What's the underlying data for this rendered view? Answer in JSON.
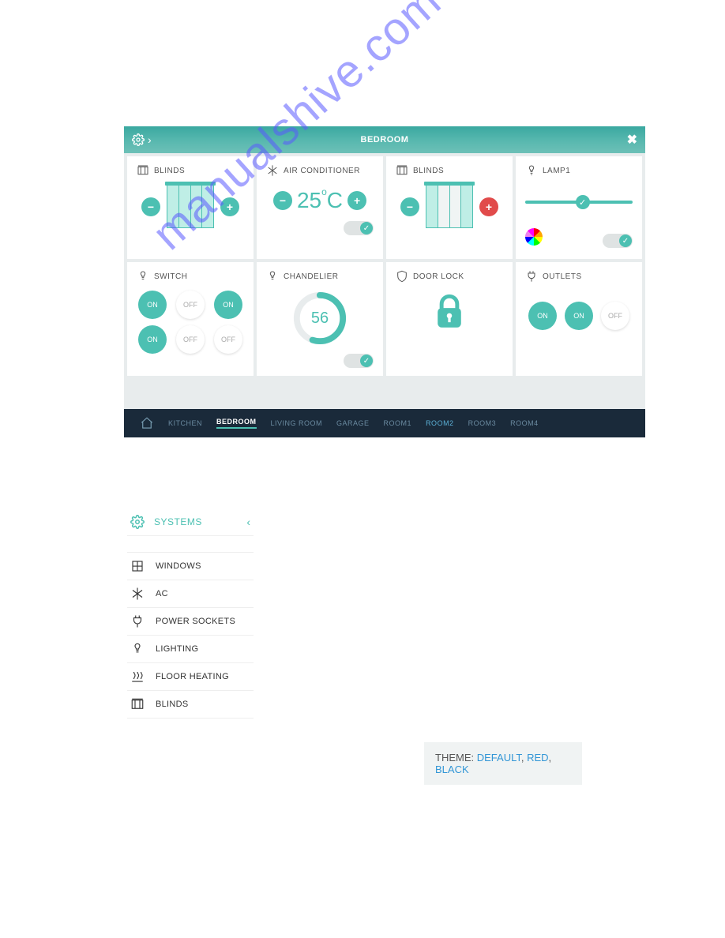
{
  "titlebar": {
    "title": "BEDROOM"
  },
  "cards": {
    "blinds1": {
      "label": "BLINDS"
    },
    "ac": {
      "label": "AIR CONDITIONER",
      "temp_value": "25",
      "temp_unit": "C"
    },
    "blinds2": {
      "label": "BLINDS"
    },
    "lamp": {
      "label": "LAMP1"
    },
    "switch": {
      "label": "SWITCH",
      "btns": [
        "ON",
        "OFF",
        "ON",
        "ON",
        "OFF",
        "OFF"
      ]
    },
    "chandelier": {
      "label": "CHANDELIER",
      "value": "56"
    },
    "doorlock": {
      "label": "DOOR LOCK"
    },
    "outlets": {
      "label": "OUTLETS",
      "btns": [
        "ON",
        "ON",
        "OFF"
      ]
    }
  },
  "rooms": [
    "KITCHEN",
    "BEDROOM",
    "LIVING ROOM",
    "GARAGE",
    "ROOM1",
    "ROOM2",
    "ROOM3",
    "ROOM4"
  ],
  "systems": {
    "title": "SYSTEMS",
    "items": [
      {
        "label": "WINDOWS"
      },
      {
        "label": "AC"
      },
      {
        "label": "POWER SOCKETS"
      },
      {
        "label": "LIGHTING"
      },
      {
        "label": "FLOOR HEATING"
      },
      {
        "label": "BLINDS"
      }
    ]
  },
  "theme": {
    "prefix": "THEME: ",
    "opts": [
      "DEFAULT",
      "RED",
      "BLACK"
    ]
  },
  "watermark": "manualshive.com",
  "chart_data": {
    "type": "bar",
    "title": "",
    "categories": [],
    "values": []
  }
}
